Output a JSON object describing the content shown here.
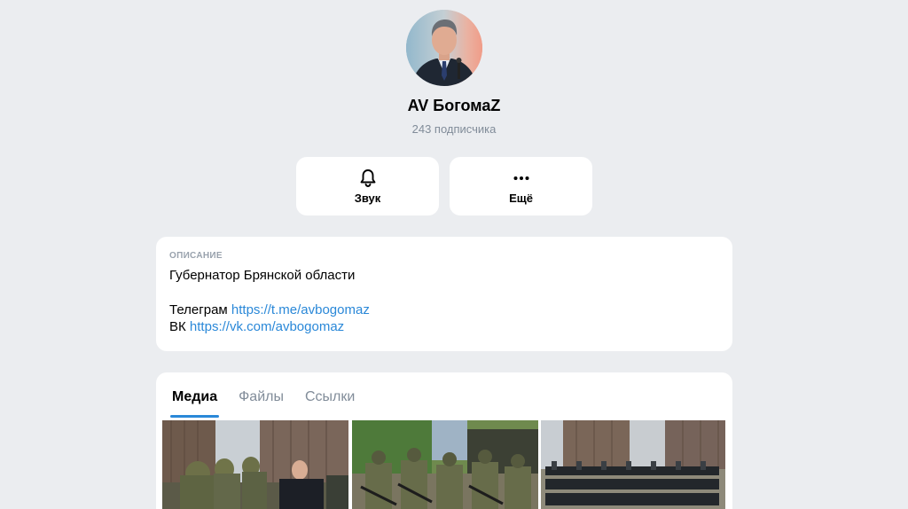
{
  "channel": {
    "name": "AV БогомаZ",
    "subscribers": "243 подписчика"
  },
  "actions": {
    "sound_label": "Звук",
    "more_label": "Ещё"
  },
  "description": {
    "heading": "Описание",
    "text": "Губернатор Брянской области",
    "telegram_label": "Телеграм",
    "telegram_link": "https://t.me/avbogomaz",
    "vk_label": "ВК",
    "vk_link": "https://vk.com/avbogomaz"
  },
  "tabs": [
    {
      "label": "Медиа",
      "active": true
    },
    {
      "label": "Файлы",
      "active": false
    },
    {
      "label": "Ссылки",
      "active": false
    }
  ],
  "colors": {
    "background": "#ebedf0",
    "card": "#ffffff",
    "accent": "#2a88d8",
    "secondary_text": "#818c99"
  },
  "icons": {
    "sound": "bell-icon",
    "more": "more-dots-icon"
  }
}
